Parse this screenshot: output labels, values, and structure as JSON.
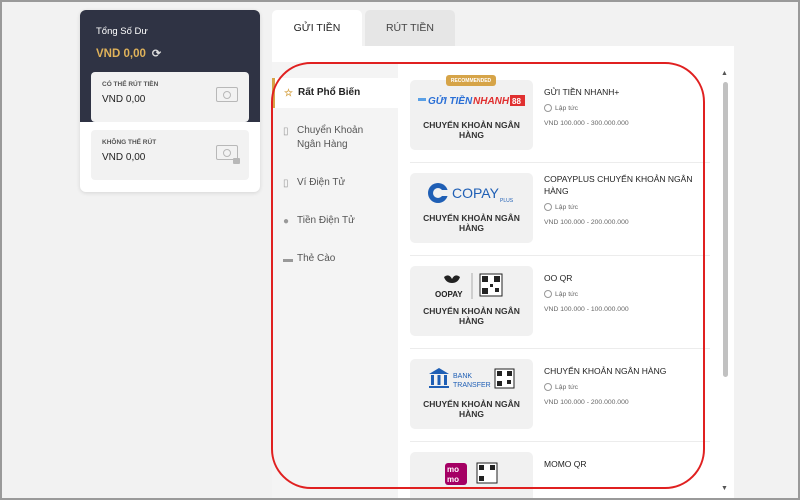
{
  "balance": {
    "title": "Tổng Số Dư",
    "amount": "VND  0,00",
    "withdrawable_label": "CÓ THỂ RÚT TIỀN",
    "withdrawable_value": "VND  0,00",
    "locked_label": "KHÔNG THỂ RÚT",
    "locked_value": "VND  0,00"
  },
  "tabs": [
    {
      "label": "GỬI TIỀN",
      "active": true
    },
    {
      "label": "RÚT TIỀN",
      "active": false
    }
  ],
  "sidebar": {
    "items": [
      {
        "label": "Rất Phổ Biến",
        "icon": "star-icon",
        "active": true
      },
      {
        "label": "Chuyển Khoản Ngân Hàng",
        "icon": "bank-icon"
      },
      {
        "label": "Ví Điện Tử",
        "icon": "wallet-icon"
      },
      {
        "label": "Tiền Điện Tử",
        "icon": "bitcoin-icon"
      },
      {
        "label": "Thẻ Cào",
        "icon": "card-icon"
      }
    ]
  },
  "methods": [
    {
      "badge": "RECOMMENDED",
      "logo": "GỬI TIỀN NHANH 88",
      "logo_sub": "CHUYỂN KHOẢN NGÂN HÀNG",
      "name": "GỬI TIỀN NHANH+",
      "speed": "Lập tức",
      "range": "VND 100.000 - 300.000.000"
    },
    {
      "logo": "COPAY PLUS",
      "logo_sub": "CHUYỂN KHOẢN NGÂN HÀNG",
      "name": "COPAYPLUS CHUYỂN KHOẢN NGÂN HÀNG",
      "speed": "Lập tức",
      "range": "VND 100.000 - 200.000.000"
    },
    {
      "logo": "OOPAY",
      "logo_sub": "CHUYỂN KHOẢN NGÂN HÀNG",
      "name": "OO QR",
      "speed": "Lập tức",
      "range": "VND 100.000 - 100.000.000"
    },
    {
      "logo": "BANK TRANSFER",
      "logo_sub": "CHUYỂN KHOẢN NGÂN HÀNG",
      "name": "CHUYỂN KHOẢN NGÂN HÀNG",
      "speed": "Lập tức",
      "range": "VND 100.000 - 200.000.000"
    },
    {
      "logo": "mo mo",
      "name": "MOMO QR"
    }
  ],
  "colors": {
    "accent": "#d6a448",
    "dark": "#2f3344",
    "highlight": "#e02020"
  }
}
